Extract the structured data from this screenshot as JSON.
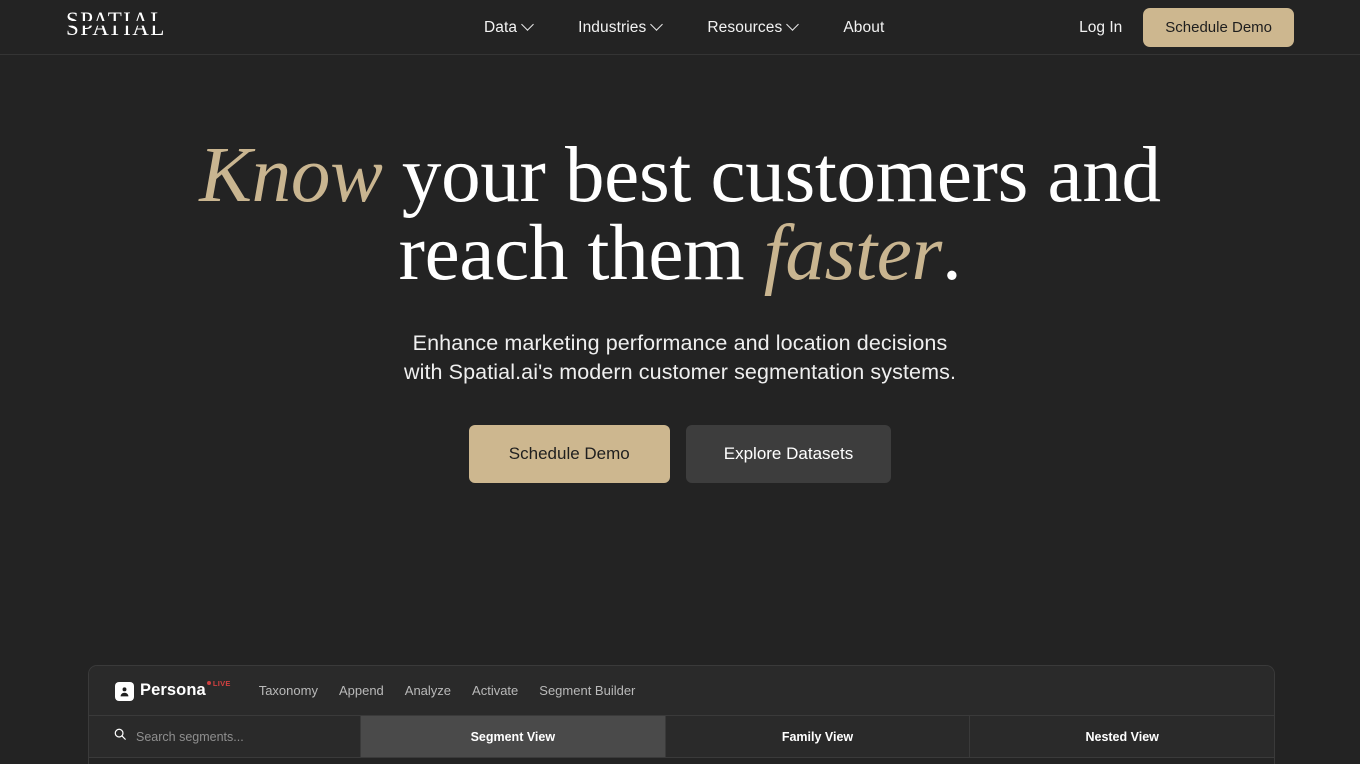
{
  "colors": {
    "page_bg": "#232323",
    "accent_tan": "#cdb78f",
    "heading_accent": "#c9b590",
    "secondary_button": "#3d3d3d",
    "live_red": "#d04040",
    "panel_bg": "#2a2a2a",
    "active_tab_bg": "#4a4a4a"
  },
  "nav": {
    "logo": "SPATIAL",
    "links": [
      {
        "label": "Data",
        "has_dropdown": true
      },
      {
        "label": "Industries",
        "has_dropdown": true
      },
      {
        "label": "Resources",
        "has_dropdown": true
      },
      {
        "label": "About",
        "has_dropdown": false
      }
    ],
    "login_label": "Log In",
    "demo_label": "Schedule Demo"
  },
  "hero": {
    "title_part1": "Know",
    "title_part2": " your best customers and reach them ",
    "title_part3": "faster",
    "title_part4": ".",
    "subtitle": "Enhance marketing performance and location decisions with Spatial.ai's modern customer segmentation systems.",
    "primary_cta": "Schedule Demo",
    "secondary_cta": "Explore Datasets"
  },
  "app_panel": {
    "brand_name": "Persona",
    "live_label": "LIVE",
    "menu": [
      {
        "label": "Taxonomy"
      },
      {
        "label": "Append"
      },
      {
        "label": "Analyze"
      },
      {
        "label": "Activate"
      },
      {
        "label": "Segment Builder"
      }
    ],
    "search": {
      "placeholder": "Search segments...",
      "value": ""
    },
    "tabs": [
      {
        "label": "Segment View",
        "active": true
      },
      {
        "label": "Family View",
        "active": false
      },
      {
        "label": "Nested View",
        "active": false
      }
    ]
  }
}
